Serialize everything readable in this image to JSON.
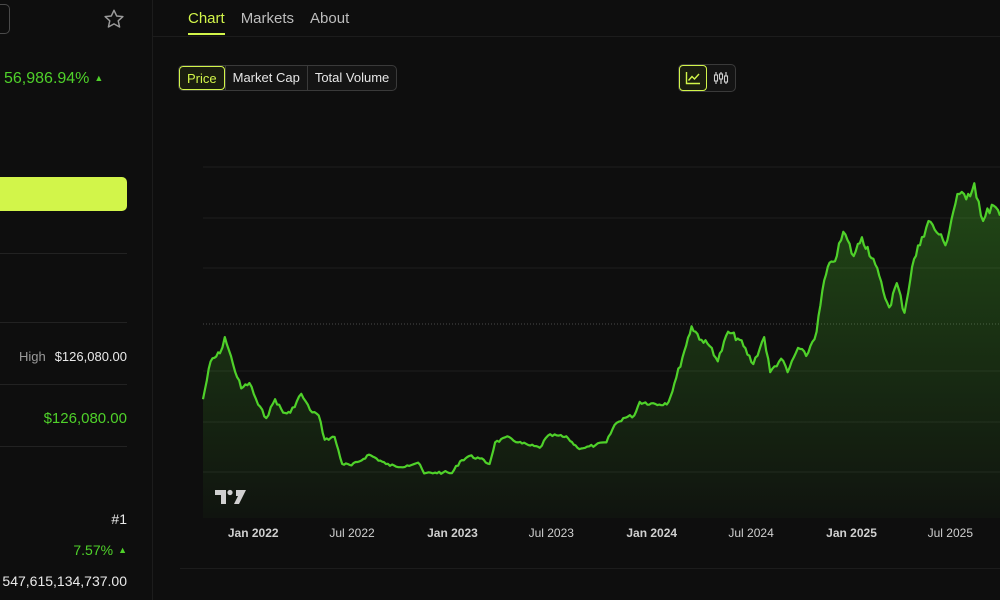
{
  "sidebar": {
    "change_percent": "56,986.94%",
    "high_label": "High",
    "high_value": "$126,080.00",
    "green_value": "$126,080.00",
    "rank": "#1",
    "percent_2": "7.57%",
    "partial_value": "547,615,134,737.00"
  },
  "tabs": [
    {
      "label": "Chart"
    },
    {
      "label": "Markets"
    },
    {
      "label": "About"
    }
  ],
  "metrics": [
    {
      "label": "Price"
    },
    {
      "label": "Market Cap"
    },
    {
      "label": "Total Volume"
    }
  ],
  "colors": {
    "accent": "#d2f54a",
    "line": "#4fd12a",
    "background": "#0e0e0e"
  },
  "chart_data": {
    "type": "area",
    "x_tick_labels": [
      "Jan 2022",
      "Jul 2022",
      "Jan 2023",
      "Jul 2023",
      "Jan 2024",
      "Jul 2024",
      "Jan 2025",
      "Jul 2025"
    ],
    "x_range": [
      "2021-10-01",
      "2025-09-30"
    ],
    "grid": "horizontal",
    "reference_line": "dotted horizontal",
    "series": [
      {
        "x": [
          "2021-10-01",
          "2021-10-15",
          "2021-11-01",
          "2021-11-10",
          "2021-11-25",
          "2021-12-10",
          "2021-12-25",
          "2022-01-10",
          "2022-01-25",
          "2022-02-10",
          "2022-02-25",
          "2022-03-10",
          "2022-03-30",
          "2022-04-15",
          "2022-05-01",
          "2022-05-12",
          "2022-05-30",
          "2022-06-13",
          "2022-06-30",
          "2022-07-15",
          "2022-08-01",
          "2022-08-15",
          "2022-09-01",
          "2022-09-20",
          "2022-10-10",
          "2022-10-30",
          "2022-11-10",
          "2022-11-30",
          "2022-12-15",
          "2022-12-31",
          "2023-01-15",
          "2023-02-01",
          "2023-02-20",
          "2023-03-10",
          "2023-03-20",
          "2023-04-15",
          "2023-05-01",
          "2023-05-20",
          "2023-06-10",
          "2023-06-25",
          "2023-07-15",
          "2023-08-01",
          "2023-08-18",
          "2023-09-01",
          "2023-09-20",
          "2023-10-10",
          "2023-10-25",
          "2023-11-10",
          "2023-11-30",
          "2023-12-10",
          "2023-12-31",
          "2024-01-15",
          "2024-02-01",
          "2024-02-15",
          "2024-03-01",
          "2024-03-14",
          "2024-04-01",
          "2024-04-20",
          "2024-05-01",
          "2024-05-20",
          "2024-06-10",
          "2024-07-05",
          "2024-07-25",
          "2024-08-05",
          "2024-08-25",
          "2024-09-06",
          "2024-09-25",
          "2024-10-10",
          "2024-10-29",
          "2024-11-12",
          "2024-11-25",
          "2024-12-05",
          "2024-12-17",
          "2025-01-05",
          "2025-01-20",
          "2025-02-10",
          "2025-02-28",
          "2025-03-11",
          "2025-03-25",
          "2025-04-08",
          "2025-04-22",
          "2025-05-10",
          "2025-05-22",
          "2025-06-10",
          "2025-06-22",
          "2025-07-14",
          "2025-07-30",
          "2025-08-14",
          "2025-08-30",
          "2025-09-15",
          "2025-09-30"
        ],
        "y": [
          44000,
          58000,
          61000,
          67000,
          57000,
          48000,
          50000,
          42000,
          37000,
          44000,
          39000,
          39000,
          46000,
          40000,
          38000,
          29000,
          30000,
          20000,
          19500,
          21000,
          23500,
          22000,
          20000,
          19000,
          19500,
          20500,
          16500,
          16800,
          16900,
          16600,
          21000,
          23000,
          22000,
          20000,
          28000,
          30000,
          28000,
          27000,
          26000,
          30500,
          30500,
          29500,
          26000,
          26000,
          27000,
          28000,
          34500,
          37000,
          38000,
          43000,
          42500,
          42000,
          43000,
          52000,
          62000,
          71000,
          66000,
          63000,
          58000,
          69000,
          66000,
          57000,
          67000,
          54000,
          59000,
          54000,
          63000,
          60000,
          69000,
          88000,
          95000,
          97000,
          106000,
          97000,
          104000,
          96000,
          84000,
          78000,
          87000,
          76000,
          93000,
          104000,
          110000,
          105000,
          101000,
          120000,
          118000,
          124000,
          110000,
          116000,
          112000
        ]
      }
    ]
  }
}
